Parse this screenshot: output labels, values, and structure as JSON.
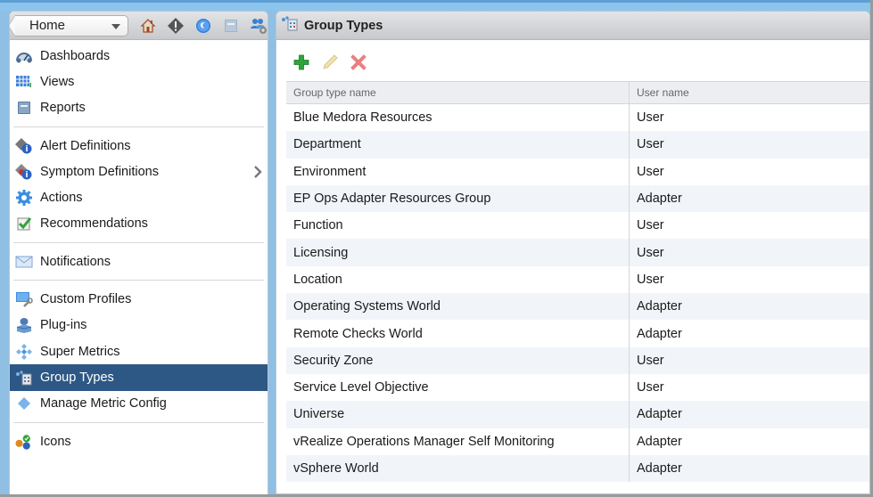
{
  "colors": {
    "accent": "#2d5784",
    "row_alt": "#f1f5fa",
    "add_icon": "#2ea43a",
    "delete_icon": "#e07a7a"
  },
  "left_panel": {
    "home_select": {
      "value": "Home"
    },
    "header_icons": [
      {
        "name": "home-icon"
      },
      {
        "name": "alert-icon"
      },
      {
        "name": "environment-globe-icon"
      },
      {
        "name": "content-icon"
      },
      {
        "name": "administration-icon"
      }
    ],
    "nav_groups": [
      [
        {
          "label": "Dashboards",
          "icon": "dashboards-icon"
        },
        {
          "label": "Views",
          "icon": "views-icon"
        },
        {
          "label": "Reports",
          "icon": "reports-icon"
        }
      ],
      [
        {
          "label": "Alert Definitions",
          "icon": "alert-definitions-icon"
        },
        {
          "label": "Symptom Definitions",
          "icon": "symptom-definitions-icon",
          "has_submenu": true
        },
        {
          "label": "Actions",
          "icon": "actions-icon"
        },
        {
          "label": "Recommendations",
          "icon": "recommendations-icon"
        }
      ],
      [
        {
          "label": "Notifications",
          "icon": "notifications-icon"
        }
      ],
      [
        {
          "label": "Custom Profiles",
          "icon": "custom-profiles-icon"
        },
        {
          "label": "Plug-ins",
          "icon": "plug-ins-icon"
        },
        {
          "label": "Super Metrics",
          "icon": "super-metrics-icon"
        },
        {
          "label": "Group Types",
          "icon": "group-types-icon",
          "active": true
        },
        {
          "label": "Manage Metric Config",
          "icon": "manage-metric-config-icon"
        }
      ],
      [
        {
          "label": "Icons",
          "icon": "icons-icon"
        }
      ]
    ]
  },
  "right_panel": {
    "title": "Group Types",
    "toolbar": {
      "add": "Add",
      "edit": "Edit",
      "delete": "Delete"
    },
    "table": {
      "columns": [
        "Group type name",
        "User name"
      ],
      "rows": [
        [
          "Blue Medora Resources",
          "User"
        ],
        [
          "Department",
          "User"
        ],
        [
          "Environment",
          "User"
        ],
        [
          "EP Ops Adapter Resources Group",
          "Adapter"
        ],
        [
          "Function",
          "User"
        ],
        [
          "Licensing",
          "User"
        ],
        [
          "Location",
          "User"
        ],
        [
          "Operating Systems World",
          "Adapter"
        ],
        [
          "Remote Checks World",
          "Adapter"
        ],
        [
          "Security Zone",
          "User"
        ],
        [
          "Service Level Objective",
          "User"
        ],
        [
          "Universe",
          "Adapter"
        ],
        [
          "vRealize Operations Manager Self Monitoring",
          "Adapter"
        ],
        [
          "vSphere World",
          "Adapter"
        ]
      ]
    }
  }
}
